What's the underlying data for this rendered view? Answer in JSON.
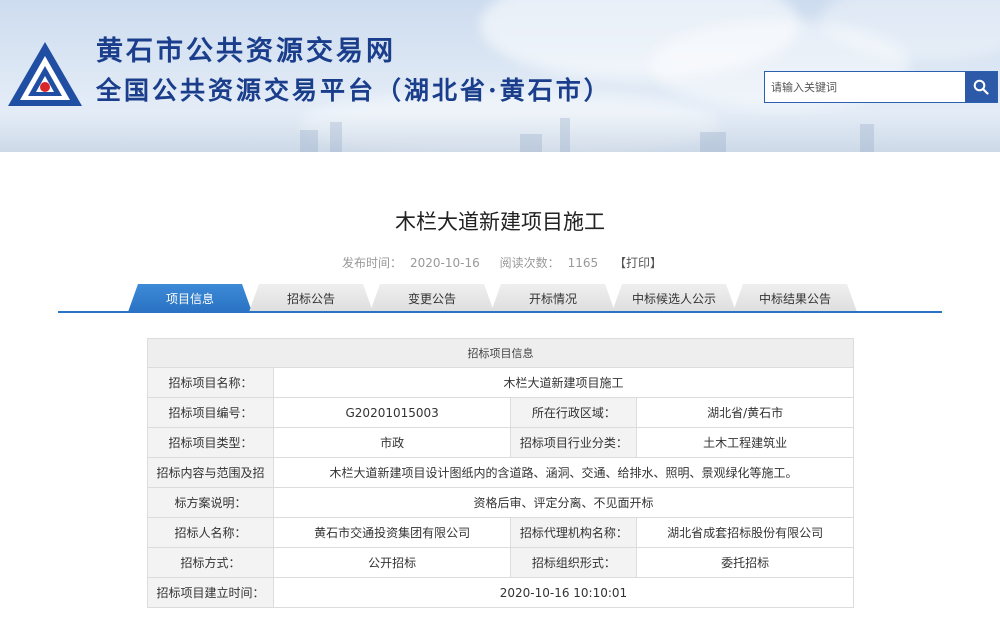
{
  "header": {
    "site_title": "黄石市公共资源交易网",
    "site_subtitle": "全国公共资源交易平台（湖北省·黄石市）",
    "search": {
      "placeholder": "请输入关键词"
    },
    "colors": {
      "brand": "#1a3e8c",
      "search_button": "#2c5aa8"
    }
  },
  "article": {
    "title": "木栏大道新建项目施工",
    "meta": {
      "publish_label": "发布时间：",
      "publish_date": "2020-10-16",
      "views_label": "阅读次数：",
      "views": "1165",
      "print": "【打印】"
    }
  },
  "tabs": [
    {
      "label": "项目信息",
      "active": true
    },
    {
      "label": "招标公告",
      "active": false
    },
    {
      "label": "变更公告",
      "active": false
    },
    {
      "label": "开标情况",
      "active": false
    },
    {
      "label": "中标候选人公示",
      "active": false
    },
    {
      "label": "中标结果公告",
      "active": false
    }
  ],
  "info": {
    "header": "招标项目信息",
    "project_name_label": "招标项目名称：",
    "project_name": "木栏大道新建项目施工",
    "project_code_label": "招标项目编号：",
    "project_code": "G20201015003",
    "region_label": "所在行政区域：",
    "region": "湖北省/黄石市",
    "project_type_label": "招标项目类型：",
    "project_type": "市政",
    "industry_label": "招标项目行业分类：",
    "industry": "土木工程建筑业",
    "scope_label_line1": "招标内容与范围及招",
    "scope_label_line2": "标方案说明：",
    "scope_line1": "木栏大道新建项目设计图纸内的含道路、涵洞、交通、给排水、照明、景观绿化等施工。",
    "scope_line2": "资格后审、评定分离、不见面开标",
    "tenderer_label": "招标人名称：",
    "tenderer": "黄石市交通投资集团有限公司",
    "agency_label": "招标代理机构名称：",
    "agency": "湖北省成套招标股份有限公司",
    "method_label": "招标方式：",
    "method": "公开招标",
    "org_form_label": "招标组织形式：",
    "org_form": "委托招标",
    "created_label": "招标项目建立时间：",
    "created": "2020-10-16 10:10:01"
  },
  "icons": {
    "logo": "triangle-logo-icon",
    "search": "search-icon"
  }
}
